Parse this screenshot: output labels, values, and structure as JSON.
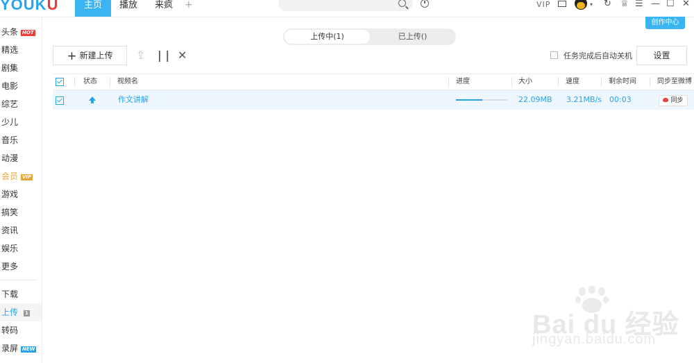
{
  "topbar": {
    "logo": {
      "prefix": "YOUK",
      "suffix": "U"
    },
    "tabs": [
      {
        "label": "主页",
        "active": true
      },
      {
        "label": "播放",
        "active": false
      },
      {
        "label": "来疯",
        "active": false
      }
    ],
    "add_tab": "+",
    "search": {
      "placeholder": "",
      "value": ""
    },
    "vip_label": "VIP",
    "create_center": "创作中心",
    "icons": [
      "search-icon",
      "history-icon",
      "mail-icon",
      "avatar",
      "refresh-icon",
      "skin-icon",
      "menu-icon",
      "minimize-icon",
      "maximize-icon",
      "close-icon"
    ]
  },
  "sidebar": {
    "items": [
      {
        "label": "头条",
        "badge": "HOT"
      },
      {
        "label": "精选"
      },
      {
        "label": "剧集"
      },
      {
        "label": "电影"
      },
      {
        "label": "综艺"
      },
      {
        "label": "少儿"
      },
      {
        "label": "音乐"
      },
      {
        "label": "动漫"
      },
      {
        "label": "会员",
        "badge": "VIP"
      },
      {
        "label": "游戏"
      },
      {
        "label": "搞笑"
      },
      {
        "label": "资讯"
      },
      {
        "label": "娱乐"
      },
      {
        "label": "更多"
      }
    ],
    "tools": [
      {
        "label": "下载"
      },
      {
        "label": "上传",
        "badge": "1",
        "active": true
      },
      {
        "label": "转码"
      },
      {
        "label": "录屏",
        "badge": "NEW"
      }
    ]
  },
  "main": {
    "segment": {
      "uploading": "上传中(1)",
      "uploaded": "已上传()"
    },
    "new_upload_label": "新建上传",
    "toolbar_icons": [
      "upload-top-icon",
      "pause-icon",
      "delete-icon"
    ],
    "auto_shutdown_label": "任务完成后自动关机",
    "settings_label": "设置",
    "table": {
      "headers": [
        "状态",
        "视频名",
        "进度",
        "大小",
        "速度",
        "剩余时间",
        "同步至微博"
      ],
      "rows": [
        {
          "checked": true,
          "status": "uploading",
          "name": "作文讲解",
          "progress": 0.52,
          "size": "22.09MB",
          "speed": "3.21MB/s",
          "remaining": "00:03",
          "sync_label": "同步"
        }
      ]
    }
  },
  "watermark": {
    "text": "Bai  du 经验",
    "url": "jingyan.baidu.com"
  },
  "colors": {
    "accent": "#2aa3ef",
    "tab_active": "#3bb4f2",
    "row_highlight": "#eef7fd",
    "hot": "#e8403a",
    "vip": "#e4a93a"
  }
}
